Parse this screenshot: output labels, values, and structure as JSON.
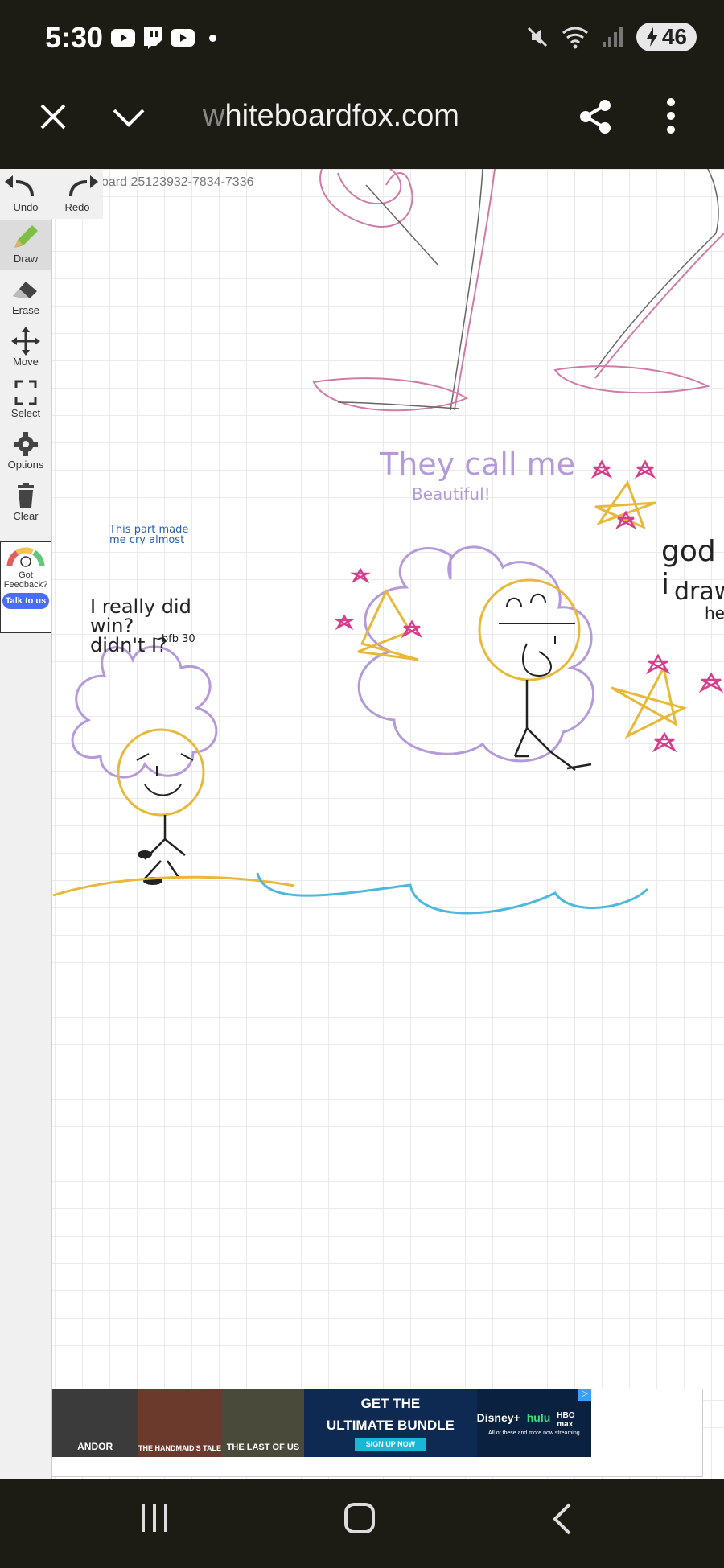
{
  "status_bar": {
    "time": "5:30",
    "battery": "46"
  },
  "browser": {
    "url_prefix": "w",
    "url": "hiteboardfox.com",
    "close_icon": "close-icon",
    "menu_icon": "chevron-down-icon"
  },
  "board": {
    "id_text": "oard 25123932-7834-7336"
  },
  "toolbar": {
    "undo": "Undo",
    "redo": "Redo",
    "draw": "Draw",
    "erase": "Erase",
    "move": "Move",
    "select": "Select",
    "options": "Options",
    "clear": "Clear"
  },
  "feedback": {
    "label": "Got Feedback?",
    "button": "Talk to us"
  },
  "drawing_text": {
    "left_note_1": "This part made me cry almost",
    "left_note_2": "I really did win? didn't I?",
    "left_sig": "~bfb 30",
    "top_phrase": "They call me",
    "beautiful": "Beautiful!",
    "right_cut_1": "god i",
    "right_cut_2": "draw",
    "right_cut_3": "her"
  },
  "ad": {
    "tile1": "ANDOR",
    "tile2": "THE HANDMAID'S TALE",
    "tile3": "THE LAST OF US",
    "headline_1": "GET THE",
    "headline_2": "ULTIMATE BUNDLE",
    "cta": "SIGN UP NOW",
    "brand_1": "Disney+",
    "brand_2": "hulu",
    "brand_3": "HBO max",
    "tagline": "All of these and more now streaming"
  },
  "colors": {
    "bar": "#1c1c14",
    "accent": "#4a6cf7",
    "purple": "#b49ad8",
    "yellow": "#e8b83a",
    "pink": "#d63d8a",
    "blue": "#4bb8e0"
  }
}
